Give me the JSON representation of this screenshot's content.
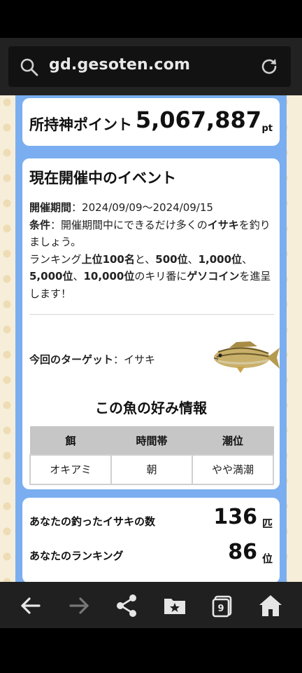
{
  "browser": {
    "url": "gd.gesoten.com",
    "search_icon": "search-icon",
    "reload_icon": "reload-icon"
  },
  "points": {
    "label": "所持神ポイント",
    "value": "5,067,887",
    "unit": "pt"
  },
  "event": {
    "heading": "現在開催中のイベント",
    "period_label": "開催期間",
    "period_sep": "：",
    "period_value": "2024/09/09〜2024/09/15",
    "condition_label": "条件",
    "condition_sep": "：",
    "condition_pre": "開催期間中にできるだけ多くの",
    "condition_fish": "イサキ",
    "condition_post": "を釣りましょう。",
    "rank_pre": "ランキング",
    "rank_top": "上位100名",
    "rank_and": "と、",
    "rank_500": "500位",
    "rank_c1": "、",
    "rank_1000": "1,000位",
    "rank_c2": "、",
    "rank_5000": "5,000位",
    "rank_c3": "、",
    "rank_10000": "10,000位",
    "rank_mid": "のキリ番に",
    "rank_coin": "ゲソコイン",
    "rank_post": "を進呈します！",
    "target_label": "今回のターゲット",
    "target_sep": "：",
    "target_value": "イサキ"
  },
  "preferences": {
    "heading": "この魚の好み情報",
    "headers": [
      "餌",
      "時間帯",
      "潮位"
    ],
    "values": [
      "オキアミ",
      "朝",
      "やや満潮"
    ]
  },
  "result": {
    "caught_label": "あなたの釣ったイサキの数",
    "caught_value": "136",
    "caught_unit": "匹",
    "rank_label": "あなたのランキング",
    "rank_value": "86",
    "rank_unit": "位"
  },
  "nav": {
    "tab_count": "9",
    "icons": [
      "back-arrow-icon",
      "forward-arrow-icon",
      "share-icon",
      "bookmarks-icon",
      "tabs-icon",
      "home-icon"
    ]
  },
  "colors": {
    "page_bg": "#f7eed9",
    "column_bg": "#7aaef0",
    "table_header": "#c6c6c6",
    "browser_bar": "#222222"
  }
}
